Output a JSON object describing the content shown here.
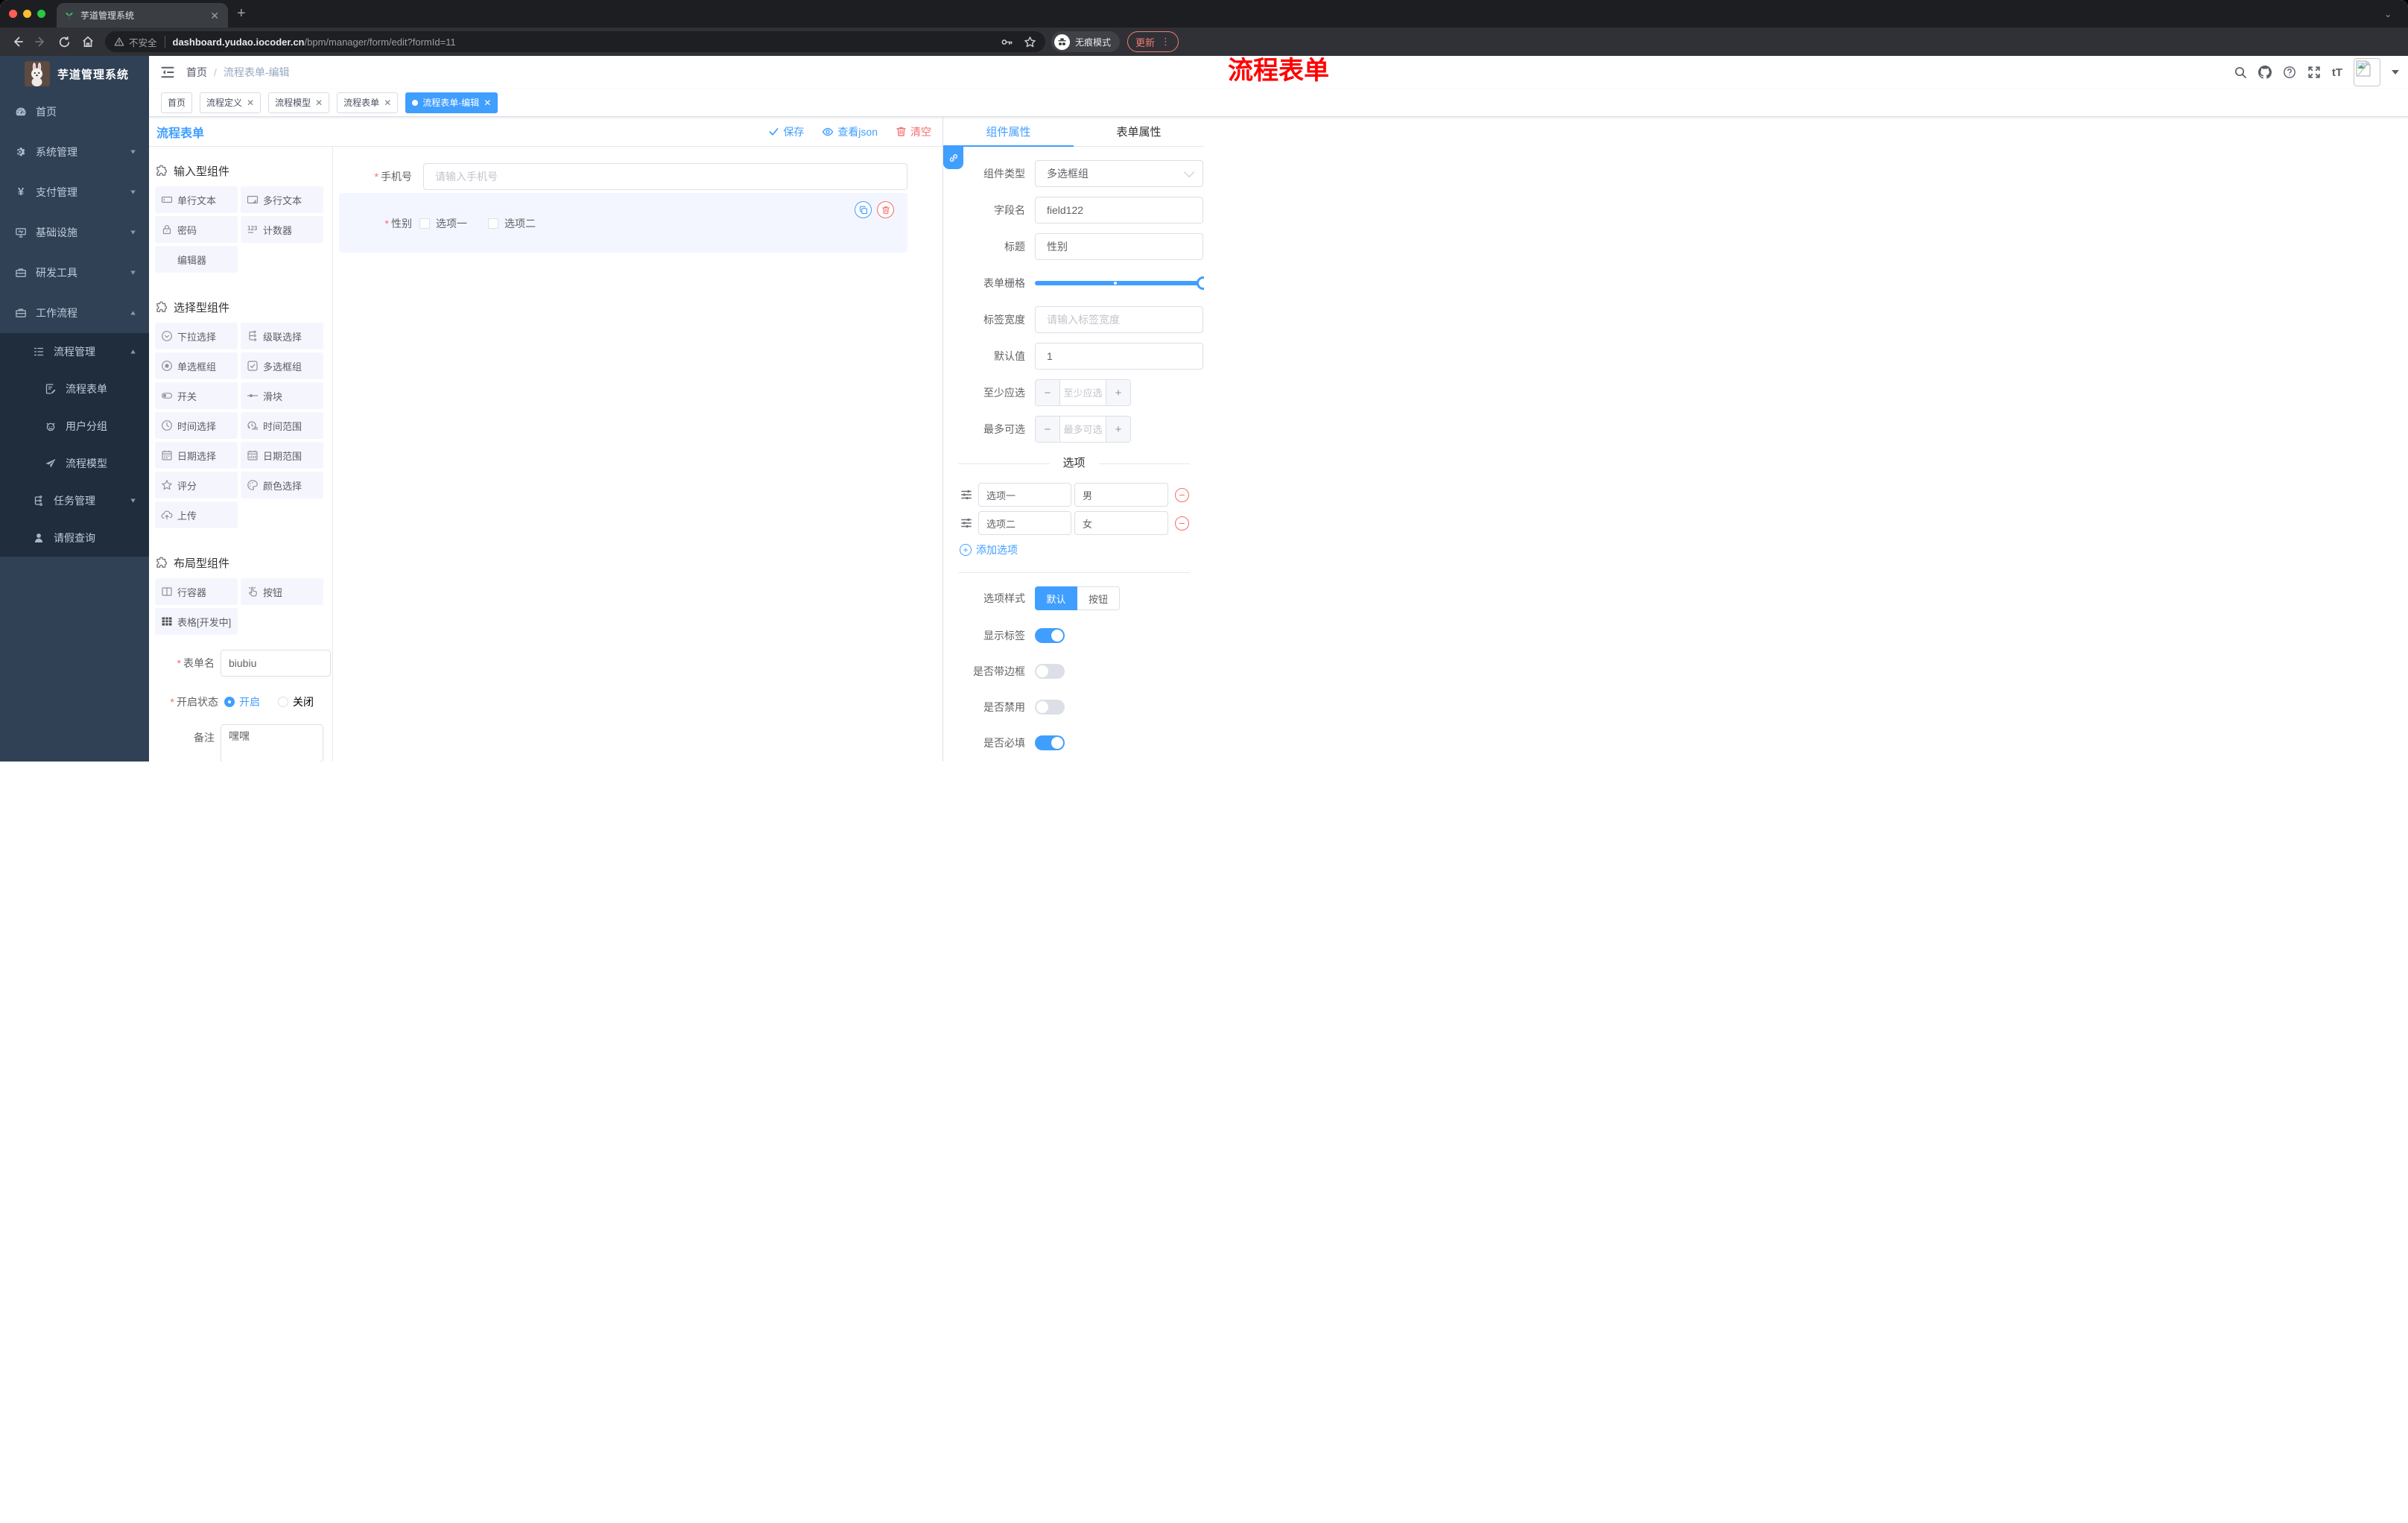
{
  "colors": {
    "accent": "#409eff",
    "danger": "#f56c6c",
    "sidebar": "#304156",
    "submenu": "#1f2d3d"
  },
  "browser": {
    "tab_title": "芋道管理系统",
    "security_label": "不安全",
    "url_host": "dashboard.yudao.iocoder.cn",
    "url_path": "/bpm/manager/form/edit?formId=11",
    "incognito_label": "无痕模式",
    "update_label": "更新",
    "menu_dots": "⋮",
    "close_glyph": "✕",
    "newtab_glyph": "+",
    "chevron_glyph": "⌄"
  },
  "sidebar": {
    "title": "芋道管理系统",
    "items": [
      {
        "label": "首页"
      },
      {
        "label": "系统管理"
      },
      {
        "label": "支付管理"
      },
      {
        "label": "基础设施"
      },
      {
        "label": "研发工具"
      },
      {
        "label": "工作流程"
      },
      {
        "label": "流程管理"
      },
      {
        "label": "流程表单"
      },
      {
        "label": "用户分组"
      },
      {
        "label": "流程模型"
      },
      {
        "label": "任务管理"
      },
      {
        "label": "请假查询"
      }
    ]
  },
  "header": {
    "breadcrumb_home": "首页",
    "breadcrumb_sep": "/",
    "breadcrumb_current": "流程表单-编辑",
    "annotation": "流程表单",
    "fontsize_glyph": "tT"
  },
  "tags": [
    {
      "label": "首页"
    },
    {
      "label": "流程定义",
      "close": "✕"
    },
    {
      "label": "流程模型",
      "close": "✕"
    },
    {
      "label": "流程表单",
      "close": "✕"
    },
    {
      "label": "流程表单-编辑",
      "close": "✕"
    }
  ],
  "toolbar": {
    "title": "流程表单",
    "save_label": "保存",
    "view_json_label": "查看json",
    "clear_label": "清空"
  },
  "components_panel": {
    "sections": [
      {
        "title": "输入型组件",
        "items": [
          "单行文本",
          "多行文本",
          "密码",
          "计数器",
          "编辑器"
        ]
      },
      {
        "title": "选择型组件",
        "items": [
          "下拉选择",
          "级联选择",
          "单选框组",
          "多选框组",
          "开关",
          "滑块",
          "时间选择",
          "时间范围",
          "日期选择",
          "日期范围",
          "评分",
          "颜色选择",
          "上传"
        ]
      },
      {
        "title": "布局型组件",
        "items": [
          "行容器",
          "按钮",
          "表格[开发中]"
        ]
      }
    ],
    "form": {
      "name_label": "表单名",
      "name_value": "biubiu",
      "status_label": "开启状态",
      "status_on": "开启",
      "status_off": "关闭",
      "remark_label": "备注",
      "remark_value": "嘿嘿"
    }
  },
  "canvas": {
    "phone_label": "手机号",
    "phone_placeholder": "请输入手机号",
    "gender_label": "性别",
    "gender_option1": "选项一",
    "gender_option2": "选项二"
  },
  "properties": {
    "tab_component": "组件属性",
    "tab_form": "表单属性",
    "type_label": "组件类型",
    "type_value": "多选框组",
    "field_label": "字段名",
    "field_value": "field122",
    "title_label": "标题",
    "title_value": "性别",
    "grid_label": "表单栅格",
    "labelwidth_label": "标签宽度",
    "labelwidth_placeholder": "请输入标签宽度",
    "default_label": "默认值",
    "default_value": "1",
    "min_label": "至少应选",
    "min_placeholder": "至少应选",
    "max_label": "最多可选",
    "max_placeholder": "最多可选",
    "options_title": "选项",
    "option1_label": "选项一",
    "option1_value": "男",
    "option2_label": "选项二",
    "option2_value": "女",
    "add_option_label": "添加选项",
    "style_label": "选项样式",
    "style_default": "默认",
    "style_button": "按钮",
    "toggle1_label": "显示标签",
    "toggle2_label": "是否带边框",
    "toggle3_label": "是否禁用",
    "toggle4_label": "是否必填"
  }
}
